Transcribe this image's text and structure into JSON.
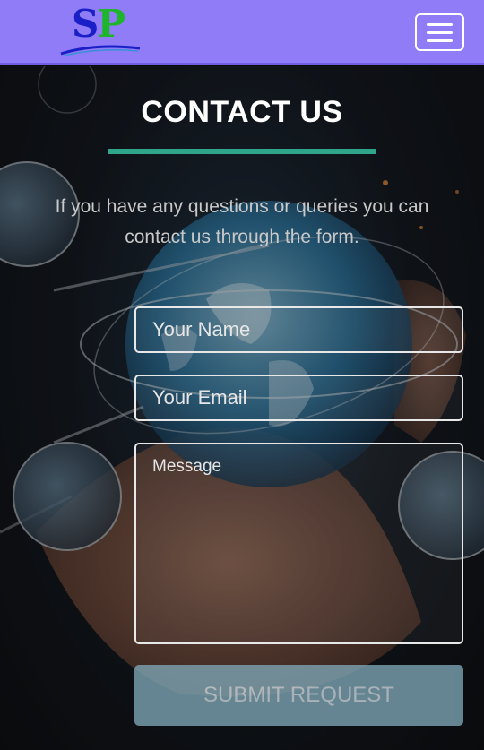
{
  "header": {
    "logo": {
      "text_s": "S",
      "text_p": "P",
      "icon": "sp-logo-icon"
    },
    "menu_icon": "hamburger-menu-icon"
  },
  "contact": {
    "title": "CONTACT US",
    "intro": "If you have any questions or queries you can contact us through the form.",
    "form": {
      "name_placeholder": "Your Name",
      "email_placeholder": "Your Email",
      "message_placeholder": "Message",
      "submit_label": "SUBMIT REQUEST"
    }
  },
  "colors": {
    "navbar": "#8f7cf6",
    "accent_rule": "#2fa58a",
    "submit_bg": "#7fa7b7",
    "logo_s": "#1a1fc8",
    "logo_p": "#1fb52a"
  }
}
